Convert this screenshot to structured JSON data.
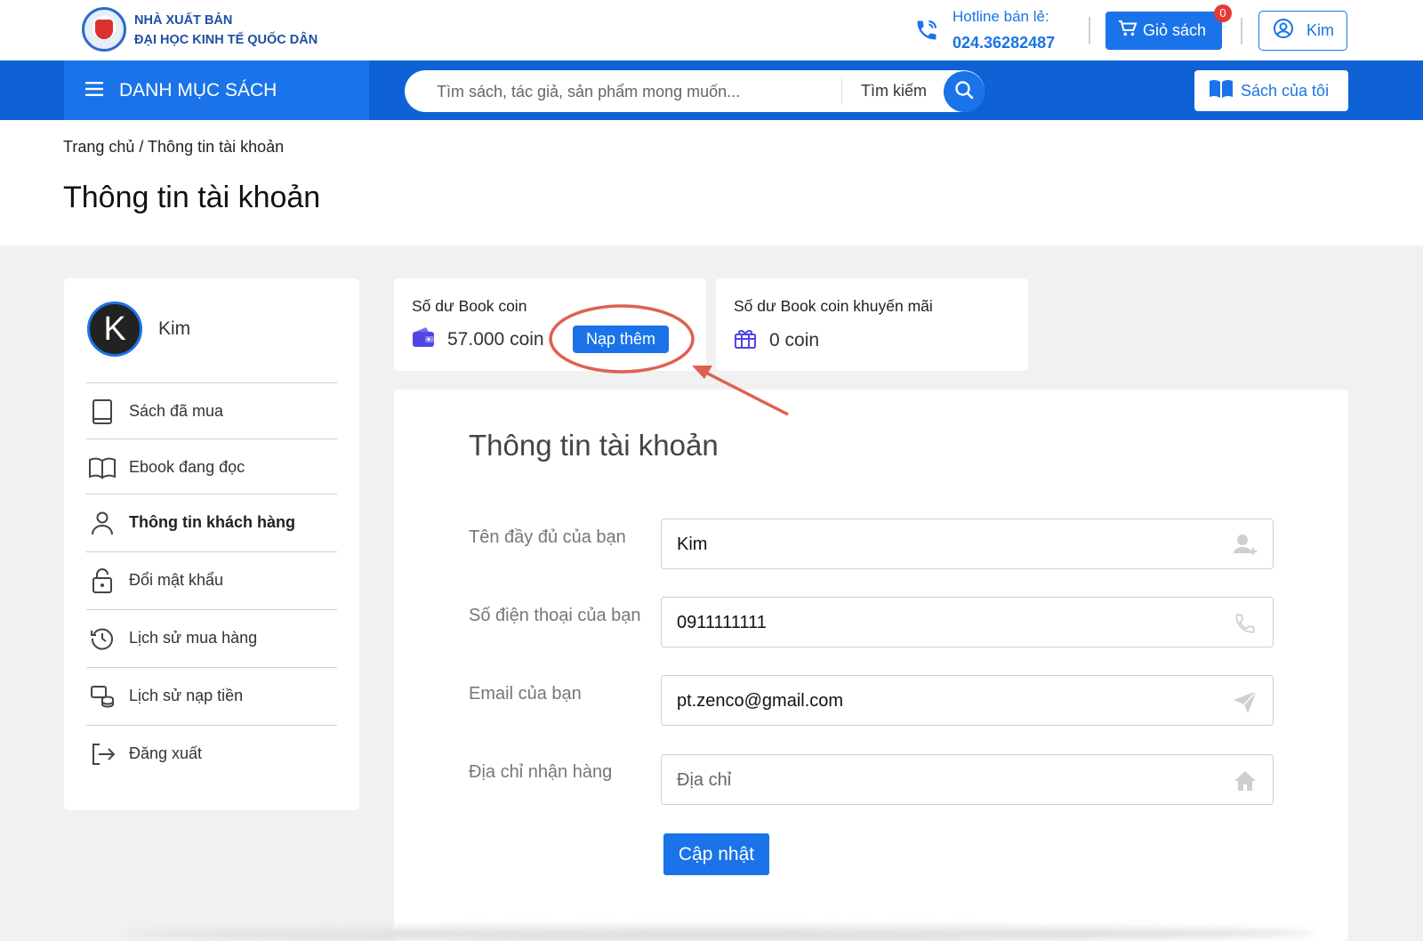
{
  "header": {
    "publisher_line1": "NHÀ XUẤT BẢN",
    "publisher_line2": "ĐẠI HỌC KINH TẾ QUỐC DÂN",
    "hotline_label": "Hotline bán lẻ:",
    "hotline_number": "024.36282487",
    "cart_label": "Giỏ sách",
    "cart_count": "0",
    "user_label": "Kim"
  },
  "nav": {
    "menu_label": "DANH MỤC SÁCH",
    "search_placeholder": "Tìm sách, tác giả, sản phẩm mong muốn...",
    "search_label": "Tìm kiếm",
    "my_books_label": "Sách của tôi"
  },
  "breadcrumb": "Trang chủ / Thông tin tài khoản",
  "page_title": "Thông tin tài khoản",
  "sidebar": {
    "avatar_letter": "K",
    "name": "Kim",
    "items": [
      {
        "label": "Sách đã mua",
        "icon": "book-icon"
      },
      {
        "label": "Ebook đang đọc",
        "icon": "open-book-icon"
      },
      {
        "label": "Thông tin khách hàng",
        "icon": "user-icon",
        "active": true
      },
      {
        "label": "Đổi mật khẩu",
        "icon": "lock-icon"
      },
      {
        "label": "Lịch sử mua hàng",
        "icon": "history-icon"
      },
      {
        "label": "Lịch sử nạp tiền",
        "icon": "coins-icon"
      },
      {
        "label": "Đăng xuất",
        "icon": "logout-icon"
      }
    ]
  },
  "coins": {
    "balance_title": "Số dư Book coin",
    "balance_value": "57.000 coin",
    "topup_label": "Nạp thêm",
    "promo_title": "Số dư Book coin khuyến mãi",
    "promo_value": "0 coin"
  },
  "form": {
    "title": "Thông tin tài khoản",
    "fullname_label": "Tên đầy đủ của bạn",
    "fullname_value": "Kim",
    "phone_label": "Số điện thoại của bạn",
    "phone_value": "0911111111",
    "email_label": "Email của bạn",
    "email_value": "pt.zenco@gmail.com",
    "address_label": "Địa chỉ nhận hàng",
    "address_placeholder": "Địa chỉ",
    "update_label": "Cập nhật"
  },
  "colors": {
    "primary": "#1a73e8",
    "nav": "#0f62d6",
    "annotation": "#e0604f"
  }
}
